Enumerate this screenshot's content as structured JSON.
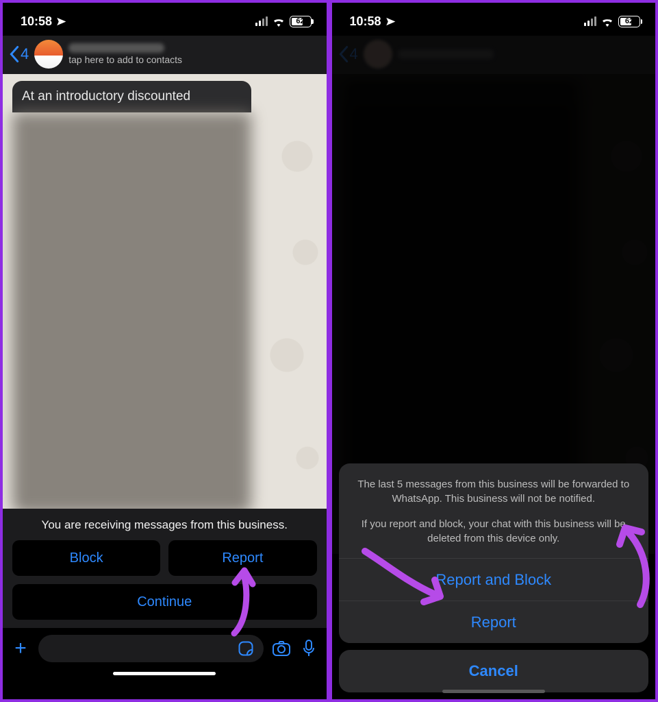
{
  "status": {
    "time": "10:58",
    "battery_pct": "62",
    "battery_fill_width": "62%"
  },
  "frame1": {
    "back_count": "4",
    "header_subtitle": "tap here to add to contacts",
    "preview_line": "At an introductory discounted",
    "panel_text": "You are receiving messages from this business.",
    "block_btn": "Block",
    "report_btn": "Report",
    "continue_btn": "Continue"
  },
  "frame2": {
    "back_count": "4",
    "sheet_p1": "The last 5 messages from this business will be forwarded to WhatsApp. This business will not be notified.",
    "sheet_p2": "If you report and block, your chat with this business will be deleted from this device only.",
    "opt_report_block": "Report and Block",
    "opt_report": "Report",
    "cancel": "Cancel"
  }
}
